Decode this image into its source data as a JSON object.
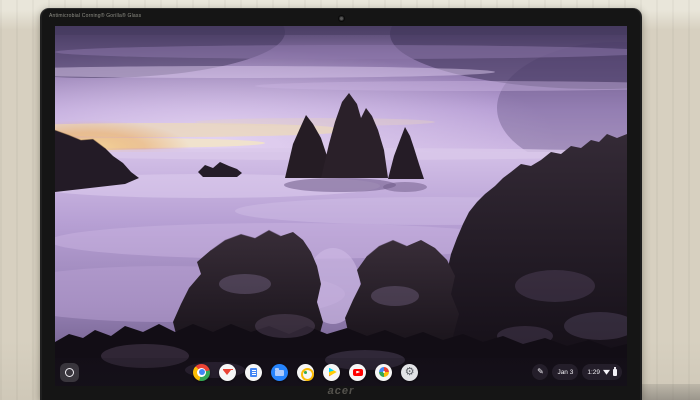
{
  "device": {
    "brand_logo": "acer",
    "bezel_sticker": "Antimicrobial Corning® Gorilla® Glass"
  },
  "shelf": {
    "launcher": {
      "label": "Launcher"
    },
    "apps": [
      {
        "name": "chrome",
        "label": "Google Chrome"
      },
      {
        "name": "gmail",
        "label": "Gmail"
      },
      {
        "name": "docs",
        "label": "Google Docs"
      },
      {
        "name": "files",
        "label": "Files"
      },
      {
        "name": "camera",
        "label": "Camera"
      },
      {
        "name": "play-store",
        "label": "Google Play Store"
      },
      {
        "name": "youtube",
        "label": "YouTube"
      },
      {
        "name": "photos",
        "label": "Google Photos"
      },
      {
        "name": "settings",
        "label": "Settings",
        "gear_glyph": "⚙"
      }
    ],
    "status": {
      "stylus": {
        "label": "Stylus tools",
        "glyph": "✎"
      },
      "date": "Jan 3",
      "time": "1:29",
      "tray_icons": [
        "wifi",
        "battery"
      ]
    }
  },
  "colors": {
    "wall": "#d7d0c0",
    "bezel": "#151515",
    "sky_top": "#51446b",
    "sky_bright": "#d9c6ec",
    "sunset_orange": "#e8a55f",
    "sunset_cream": "#f0dcae",
    "sea_light": "#c3aede",
    "sea_deep": "#63527e",
    "rock_dark": "#120d15",
    "rock_lit": "#9d87b4",
    "files_blue": "#2684fc",
    "youtube_red": "#ff0000",
    "chrome_red": "#ea4335",
    "chrome_yellow": "#fbbc05",
    "chrome_green": "#34a853",
    "chrome_blue": "#4285f4"
  }
}
